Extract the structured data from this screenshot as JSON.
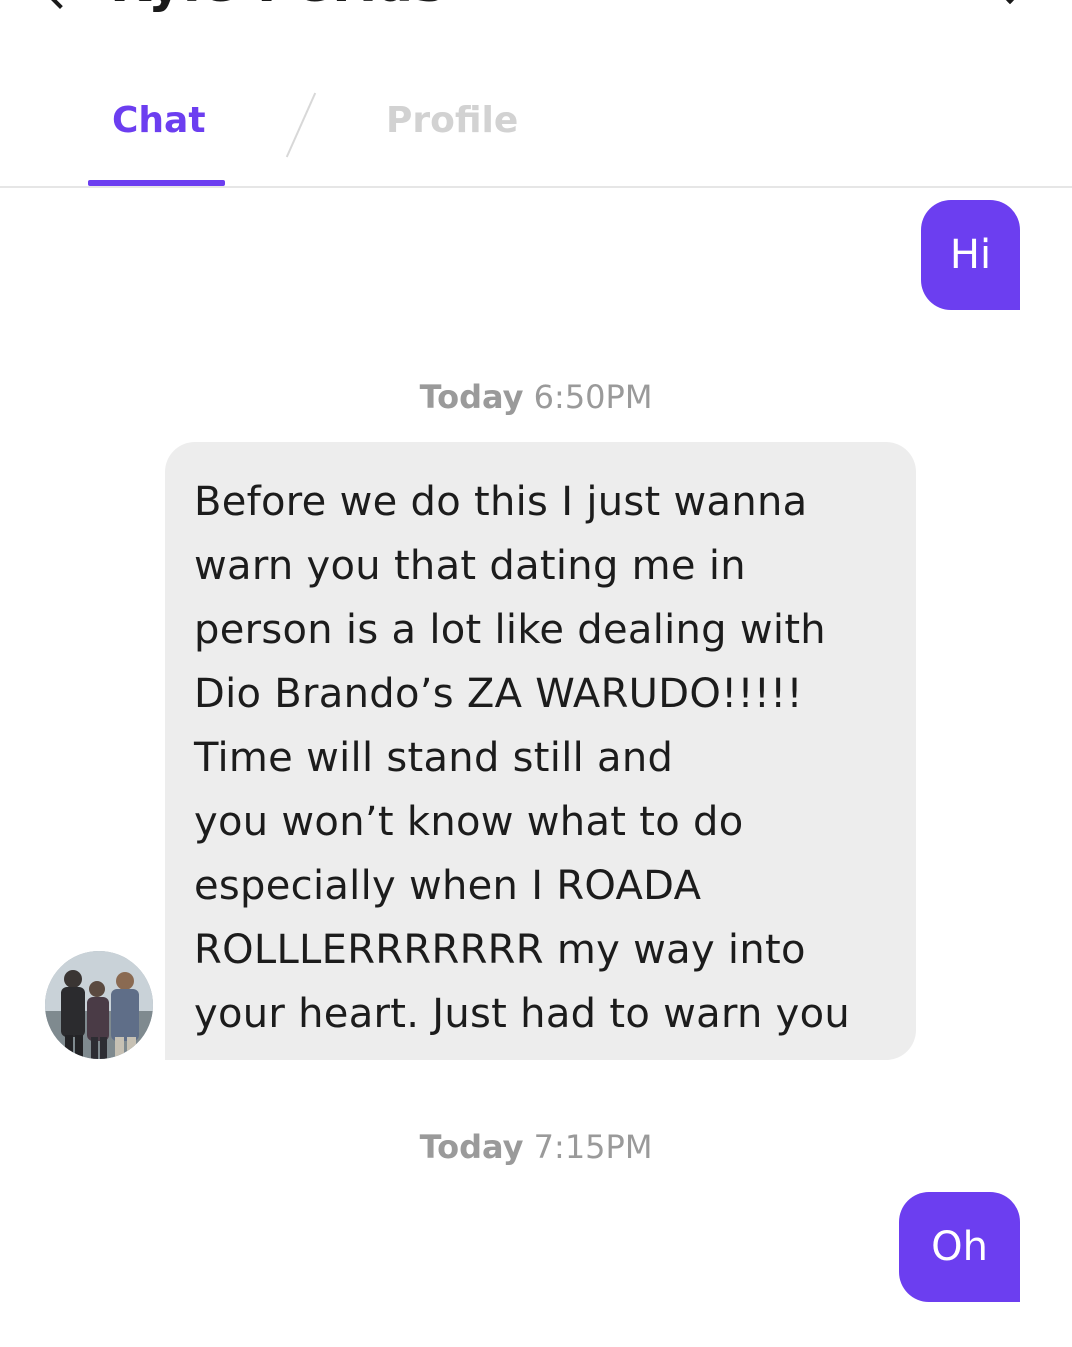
{
  "header": {
    "title": "Kyle Perlas"
  },
  "tabs": [
    {
      "label": "Chat",
      "active": true
    },
    {
      "label": "Profile",
      "active": false
    }
  ],
  "colors": {
    "accent": "#6c3ef0",
    "incoming_bubble": "#ededed",
    "timestamp": "#9a9a9a"
  },
  "messages": [
    {
      "direction": "outgoing",
      "text": "Hi"
    },
    {
      "direction": "timestamp",
      "day": "Today",
      "time": "6:50PM"
    },
    {
      "direction": "incoming",
      "text": "Before we do this I just wanna\nwarn you that dating me in\nperson is a lot like dealing with\nDio Brando’s ZA WARUDO!!!!!\nTime will stand still and\nyou won’t know what to do\nespecially when I ROADA\nROLLLERRRRRRR my way into\nyour heart. Just had to warn you"
    },
    {
      "direction": "timestamp",
      "day": "Today",
      "time": "7:15PM"
    },
    {
      "direction": "outgoing",
      "text": "Oh"
    }
  ]
}
